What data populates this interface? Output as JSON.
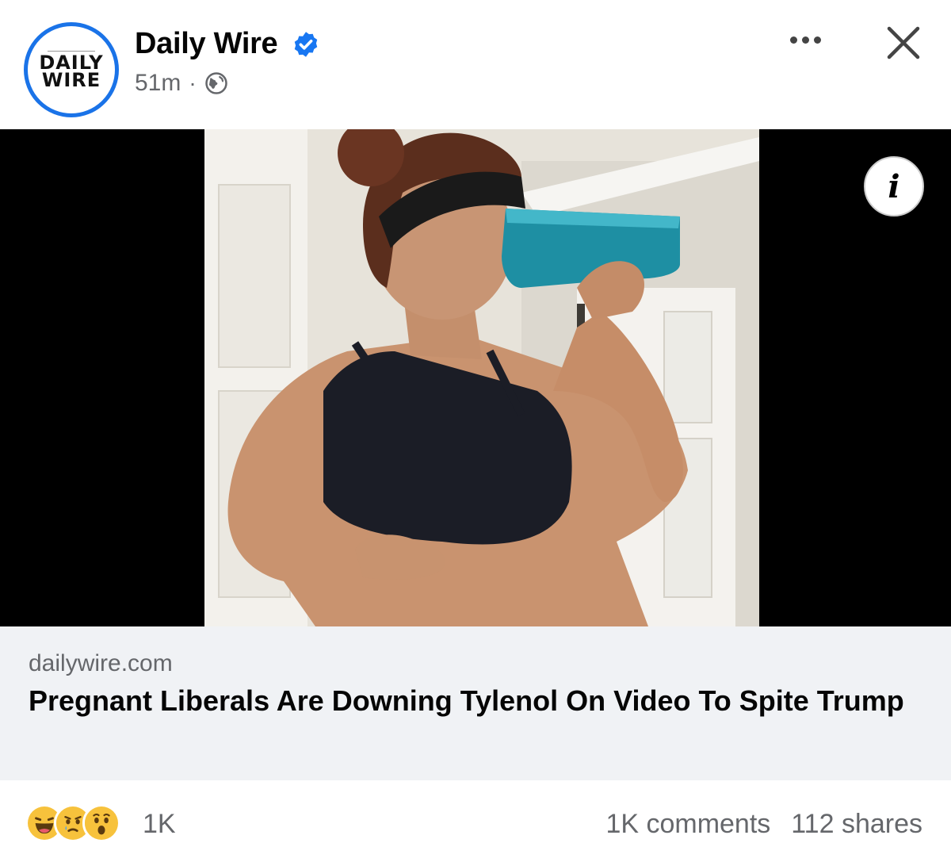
{
  "post": {
    "page_name": "Daily Wire",
    "avatar_logo_top": "DAILY",
    "avatar_logo_bottom": "WIRE",
    "timestamp": "51m",
    "separator": "·",
    "audience_icon": "globe-icon",
    "verified_icon": "verified-badge-icon",
    "verified_color": "#1877f2"
  },
  "header_actions": {
    "more_icon": "more-options-icon",
    "close_icon": "close-icon"
  },
  "media": {
    "info_label": "i"
  },
  "link_preview": {
    "domain": "dailywire.com",
    "headline": "Pregnant Liberals Are Downing Tylenol On Video To Spite Trump"
  },
  "engagement": {
    "reaction_icons": [
      "haha-reaction-icon",
      "sad-reaction-icon",
      "wow-reaction-icon"
    ],
    "reaction_count": "1K",
    "comments": "1K comments",
    "shares": "112 shares"
  }
}
